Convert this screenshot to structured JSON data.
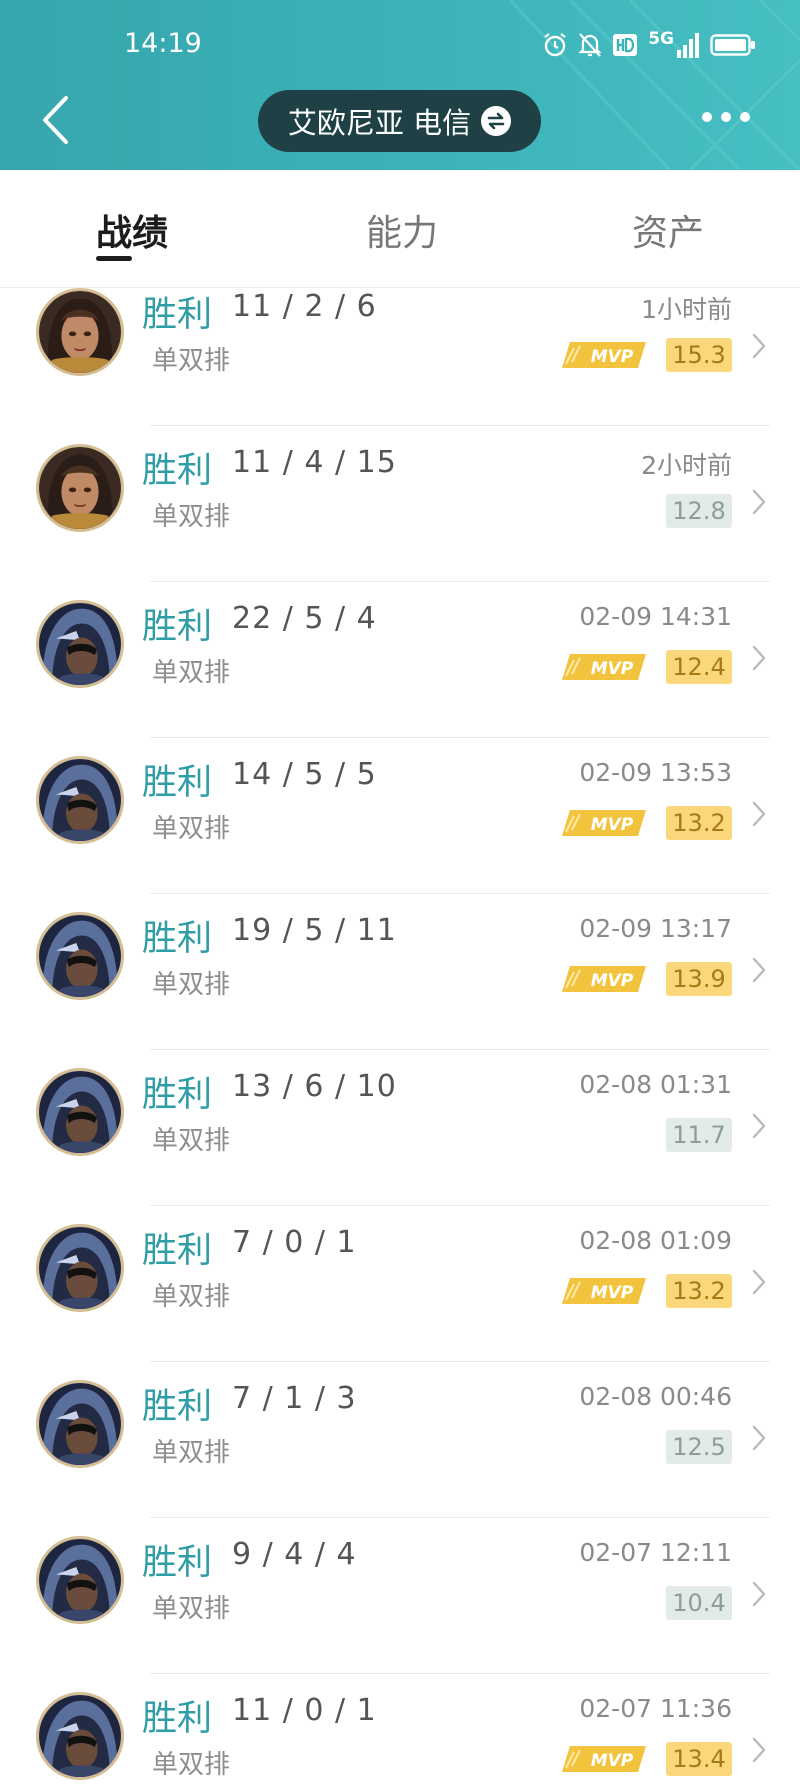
{
  "status_bar": {
    "time": "14:19",
    "network": "5G",
    "icons": [
      "alarm-icon",
      "mute-bell-icon",
      "hd-icon",
      "signal-icon",
      "battery-icon"
    ]
  },
  "header": {
    "server_name": "艾欧尼亚 电信",
    "back_icon": "back-chevron-icon",
    "swap_icon": "swap-arrows-icon",
    "more_icon": "more-dots-icon"
  },
  "tabs": [
    {
      "label": "战绩",
      "active": true
    },
    {
      "label": "能力",
      "active": false
    },
    {
      "label": "资产",
      "active": false
    }
  ],
  "mvp_label": "MVP",
  "matches": [
    {
      "champion": "champion-female-avatar",
      "result": "胜利",
      "kda": "11 / 2 / 6",
      "mode": "单双排",
      "time": "1小时前",
      "score": "15.3",
      "mvp": true
    },
    {
      "champion": "champion-female-avatar",
      "result": "胜利",
      "kda": "11 / 4 / 15",
      "mode": "单双排",
      "time": "2小时前",
      "score": "12.8",
      "mvp": false
    },
    {
      "champion": "champion-hooded-avatar",
      "result": "胜利",
      "kda": "22 / 5 / 4",
      "mode": "单双排",
      "time": "02-09 14:31",
      "score": "12.4",
      "mvp": true
    },
    {
      "champion": "champion-hooded-avatar",
      "result": "胜利",
      "kda": "14 / 5 / 5",
      "mode": "单双排",
      "time": "02-09 13:53",
      "score": "13.2",
      "mvp": true
    },
    {
      "champion": "champion-hooded-avatar",
      "result": "胜利",
      "kda": "19 / 5 / 11",
      "mode": "单双排",
      "time": "02-09 13:17",
      "score": "13.9",
      "mvp": true
    },
    {
      "champion": "champion-hooded-avatar",
      "result": "胜利",
      "kda": "13 / 6 / 10",
      "mode": "单双排",
      "time": "02-08 01:31",
      "score": "11.7",
      "mvp": false
    },
    {
      "champion": "champion-hooded-avatar",
      "result": "胜利",
      "kda": "7 / 0 / 1",
      "mode": "单双排",
      "time": "02-08 01:09",
      "score": "13.2",
      "mvp": true
    },
    {
      "champion": "champion-hooded-avatar",
      "result": "胜利",
      "kda": "7 / 1 / 3",
      "mode": "单双排",
      "time": "02-08 00:46",
      "score": "12.5",
      "mvp": false
    },
    {
      "champion": "champion-hooded-avatar",
      "result": "胜利",
      "kda": "9 / 4 / 4",
      "mode": "单双排",
      "time": "02-07 12:11",
      "score": "10.4",
      "mvp": false
    },
    {
      "champion": "champion-hooded-avatar",
      "result": "胜利",
      "kda": "11 / 0 / 1",
      "mode": "单双排",
      "time": "02-07 11:36",
      "score": "13.4",
      "mvp": true
    }
  ],
  "colors": {
    "header_teal": "#3cb3b9",
    "pill_dark": "#1f4145",
    "result_teal": "#2f9da5",
    "mvp_gold": "#f2c43d",
    "score_gold_bg": "#fad77a",
    "score_gray_bg": "#e3ebe9"
  }
}
